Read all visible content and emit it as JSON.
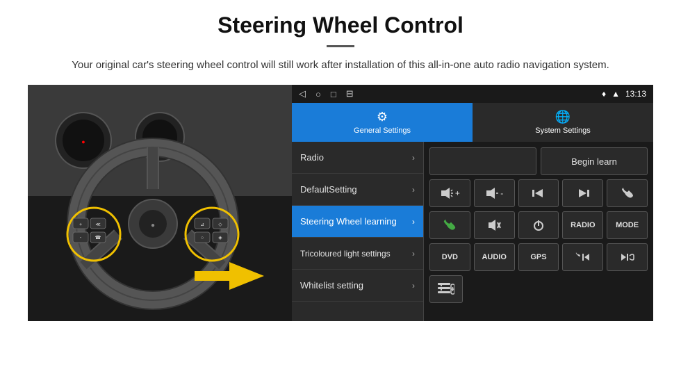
{
  "header": {
    "title": "Steering Wheel Control",
    "divider": true,
    "subtitle": "Your original car's steering wheel control will still work after installation of this all-in-one auto radio navigation system."
  },
  "status_bar": {
    "time": "13:13",
    "nav_icons": [
      "◁",
      "○",
      "□",
      "⊟"
    ]
  },
  "tabs": [
    {
      "id": "general",
      "label": "General Settings",
      "icon": "⚙",
      "active": true
    },
    {
      "id": "system",
      "label": "System Settings",
      "icon": "🌐",
      "active": false
    }
  ],
  "menu_items": [
    {
      "id": "radio",
      "label": "Radio",
      "active": false
    },
    {
      "id": "default",
      "label": "DefaultSetting",
      "active": false
    },
    {
      "id": "steering",
      "label": "Steering Wheel learning",
      "active": true
    },
    {
      "id": "tricoloured",
      "label": "Tricoloured light settings",
      "active": false
    },
    {
      "id": "whitelist",
      "label": "Whitelist setting",
      "active": false
    }
  ],
  "right_panel": {
    "begin_learn_label": "Begin learn",
    "ctrl_row1": [
      "🔊+",
      "🔊-",
      "⏮",
      "⏭",
      "📞"
    ],
    "ctrl_row1_icons": [
      "vol_up",
      "vol_down",
      "prev",
      "next",
      "phone"
    ],
    "ctrl_row2": [
      "📞",
      "🔇",
      "⏻",
      "RADIO",
      "MODE"
    ],
    "ctrl_row2_ids": [
      "answer",
      "mute",
      "power",
      "radio",
      "mode"
    ],
    "ctrl_row3": [
      "DVD",
      "AUDIO",
      "GPS",
      "📞⏮",
      "🔀⏭"
    ],
    "ctrl_row3_ids": [
      "dvd",
      "audio",
      "gps",
      "phone_prev",
      "shuffle_next"
    ],
    "whitelist_icon": "≡"
  },
  "colors": {
    "active_blue": "#1a7cd8",
    "bg_dark": "#1a1a1a",
    "bg_panel": "#2a2a2a",
    "text_light": "#e0e0e0"
  }
}
